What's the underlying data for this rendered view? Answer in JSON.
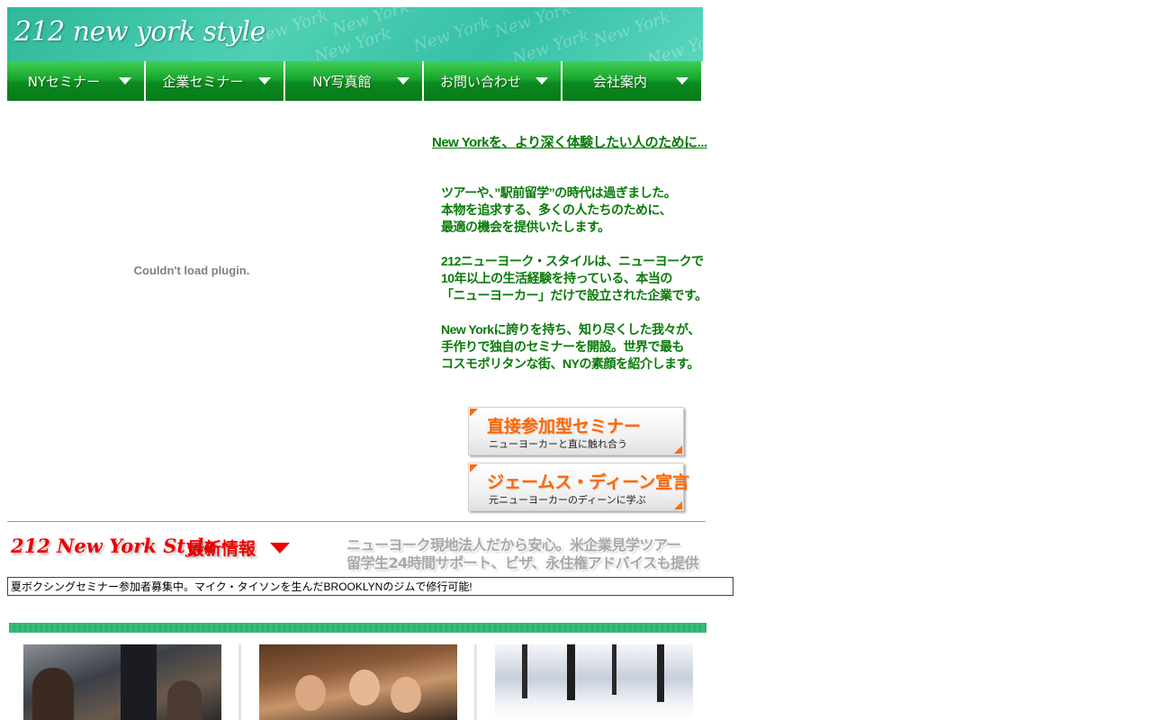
{
  "header": {
    "logo_text": "212 new york style",
    "watermark_text": "New York"
  },
  "nav": {
    "items": [
      {
        "label": "NYセミナー"
      },
      {
        "label": "企業セミナー"
      },
      {
        "label": "NY写真館"
      },
      {
        "label": "お問い合わせ"
      },
      {
        "label": "会社案内"
      }
    ]
  },
  "plugin": {
    "message": "Couldn't load plugin."
  },
  "main": {
    "tagline": "New Yorkを、より深く体験したい人のために...",
    "intro": [
      [
        "ツアーや、”駅前留学”の時代は過ぎました。",
        "本物を追求する、多くの人たちのために、",
        "最適の機会を提供いたします。"
      ],
      [
        "212ニューヨーク・スタイルは、ニューヨークで",
        "10年以上の生活経験を持っている、本当の",
        "「ニューヨーカー」だけで設立された企業です。"
      ],
      [
        "New Yorkに誇りを持ち、知り尽くした我々が、",
        "手作りで独自のセミナーを開設。世界で最も",
        "コスモポリタンな街、NYの素顔を紹介します。"
      ]
    ],
    "seminar_buttons": [
      {
        "title": "直接参加型セミナー",
        "subtitle": "ニューヨーカーと直に触れ合う"
      },
      {
        "title": "ジェームス・ディーン宣言",
        "subtitle": "元ニューヨーカーのディーンに学ぶ"
      }
    ]
  },
  "news": {
    "logo_text": "212 New York Style",
    "title": "最新情報",
    "promo": [
      "ニューヨーク現地法人だから安心。米企業見学ツアー",
      "留学生24時間サポート、ビザ、永住権アドバイスも提供"
    ],
    "ticker": "夏ボクシングセミナー参加者募集中。マイク・タイソンを生んだBROOKLYNのジムで修行可能!"
  },
  "colors": {
    "nav_green": "#1aa52e",
    "text_green": "#0a7a0a",
    "accent_orange": "#ff6600",
    "news_red": "#ee0000"
  }
}
